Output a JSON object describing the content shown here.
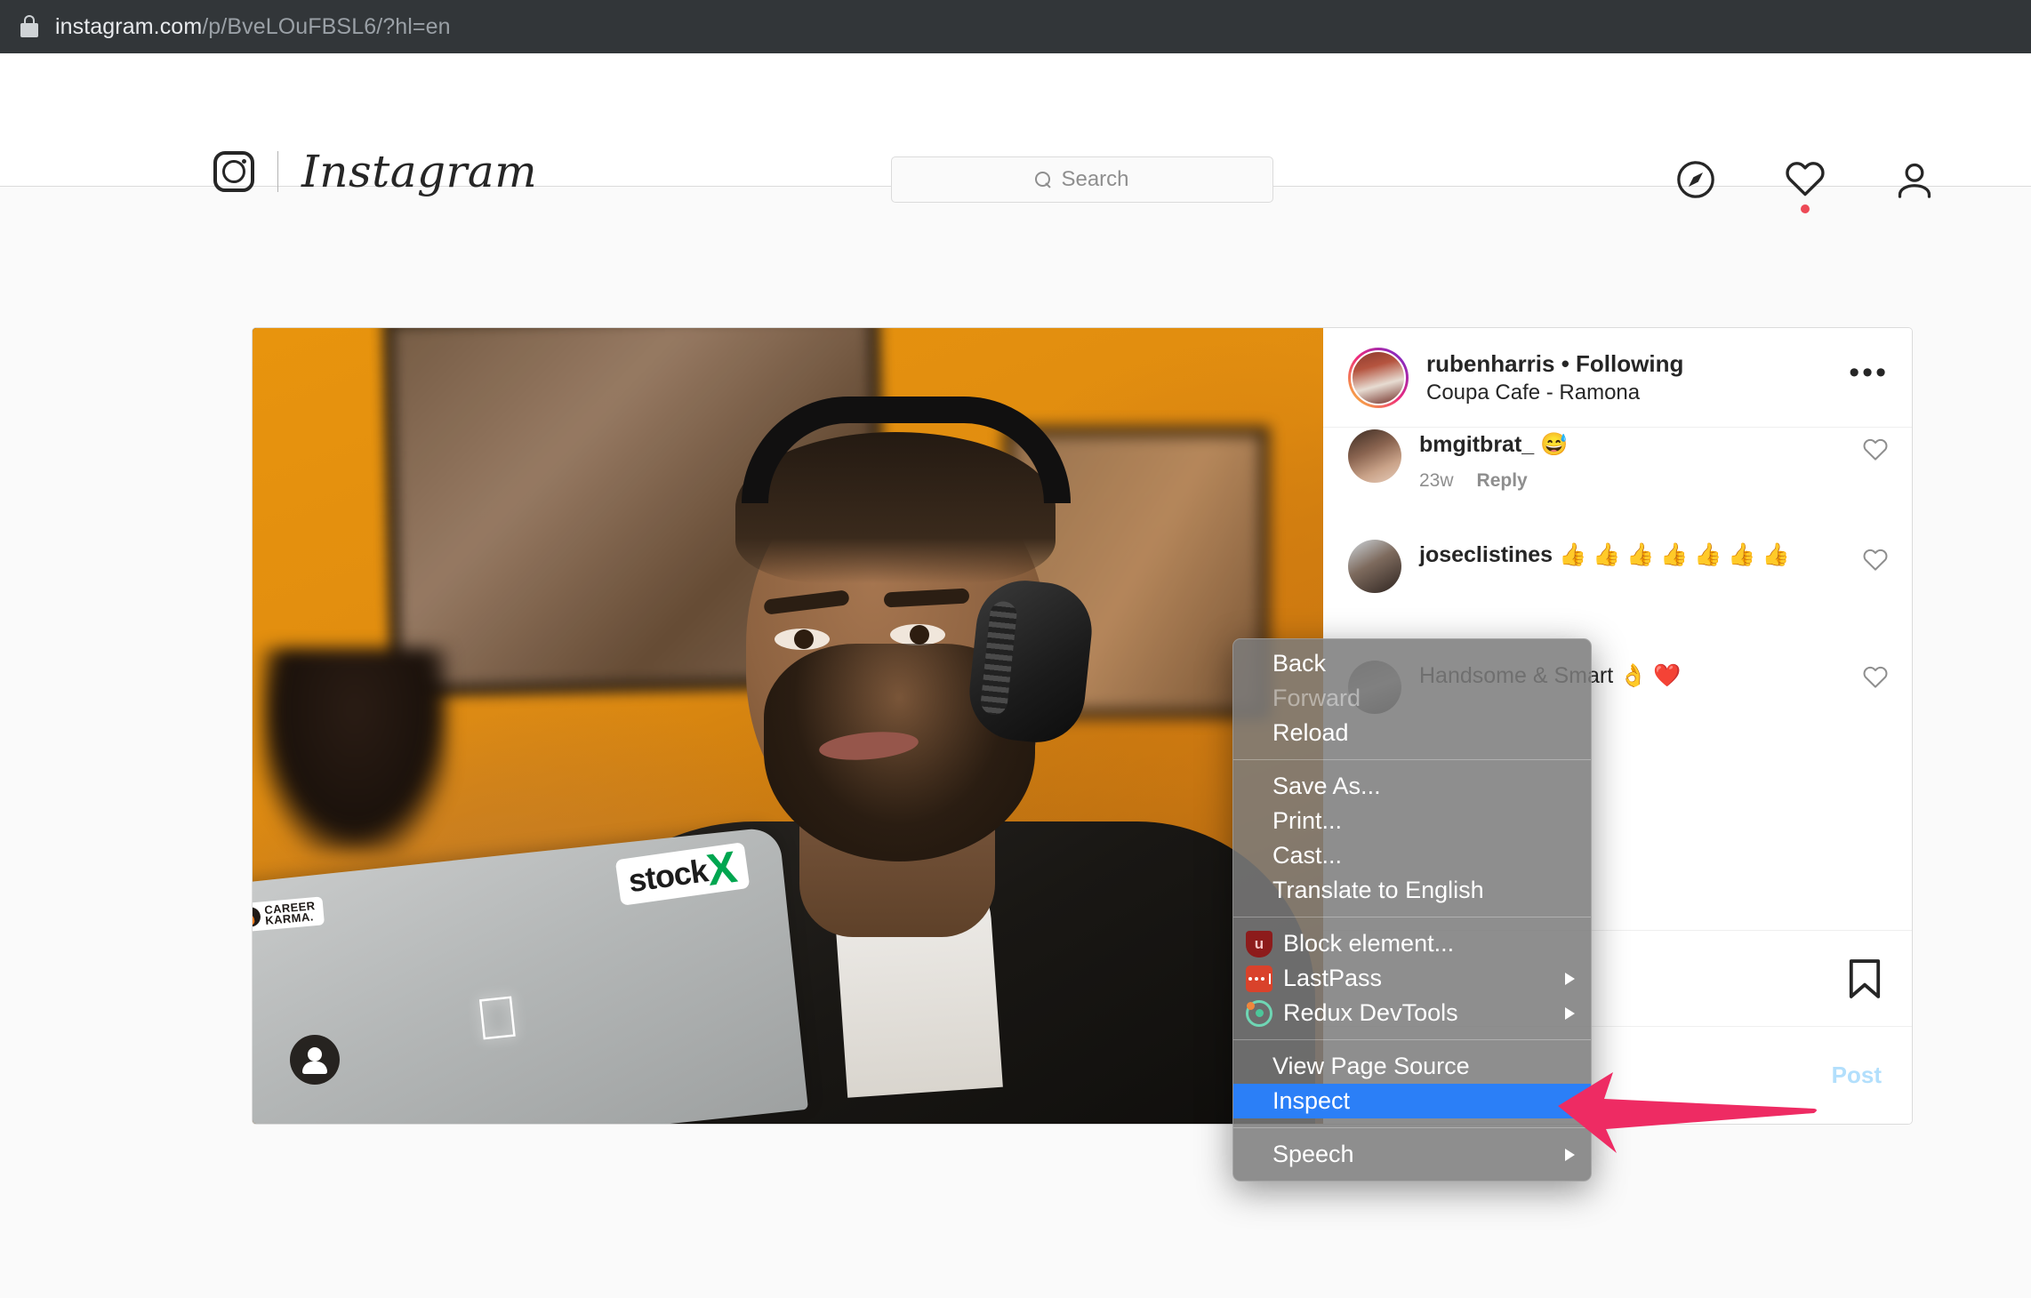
{
  "browser": {
    "lock_icon": "lock-icon",
    "url_domain": "instagram.com",
    "url_path": "/p/BveLOuFBSL6/?hl=en"
  },
  "nav": {
    "logo_icon": "instagram-camera-icon",
    "wordmark": "Instagram",
    "search": {
      "icon": "search-icon",
      "placeholder": "Search",
      "value": ""
    },
    "actions": [
      {
        "name": "explore-icon",
        "label": "Explore"
      },
      {
        "name": "activity-heart-icon",
        "label": "Activity",
        "badge": true
      },
      {
        "name": "profile-icon",
        "label": "Profile"
      }
    ]
  },
  "post": {
    "media": {
      "alt": "Man with headphones working on a MacBook in a cafe",
      "tag_badge_icon": "tagged-people-icon",
      "stickers": [
        {
          "name": "career-karma-sticker",
          "line1": "CAREER",
          "line2": "KARMA."
        },
        {
          "name": "stockx-sticker",
          "text": "stock",
          "accent": "X"
        }
      ],
      "apple_logo": ""
    },
    "header": {
      "avatar": "rubenharris-avatar",
      "username_line": "rubenharris • Following",
      "location": "Coupa Cafe - Ramona",
      "more_label": "•••"
    },
    "comments": [
      {
        "avatar": "commenter-avatar-1",
        "username": "bmgitbrat_",
        "text": " 😅",
        "time": "23w",
        "reply_label": "Reply",
        "like_icon": "heart-outline-icon"
      },
      {
        "avatar": "commenter-avatar-2",
        "username": "joseclistines",
        "text": " 👍 👍 👍 👍 👍 👍 👍",
        "time": "",
        "reply_label": "",
        "like_icon": "heart-outline-icon"
      },
      {
        "avatar": "commenter-avatar-3",
        "username": "",
        "text": "Handsome & Smart 👌 ❤️",
        "time": "",
        "reply_label": "",
        "like_icon": "heart-outline-icon"
      }
    ],
    "actions": {
      "save_icon": "bookmark-icon"
    },
    "compose": {
      "post_label": "Post"
    }
  },
  "context_menu": {
    "groups": [
      {
        "items": [
          {
            "label": "Back",
            "disabled": false,
            "icon": null,
            "submenu": false,
            "selected": false
          },
          {
            "label": "Forward",
            "disabled": true,
            "icon": null,
            "submenu": false,
            "selected": false
          },
          {
            "label": "Reload",
            "disabled": false,
            "icon": null,
            "submenu": false,
            "selected": false
          }
        ]
      },
      {
        "items": [
          {
            "label": "Save As...",
            "disabled": false,
            "icon": null,
            "submenu": false,
            "selected": false
          },
          {
            "label": "Print...",
            "disabled": false,
            "icon": null,
            "submenu": false,
            "selected": false
          },
          {
            "label": "Cast...",
            "disabled": false,
            "icon": null,
            "submenu": false,
            "selected": false
          },
          {
            "label": "Translate to English",
            "disabled": false,
            "icon": null,
            "submenu": false,
            "selected": false
          }
        ]
      },
      {
        "items": [
          {
            "label": "Block element...",
            "disabled": false,
            "icon": "ublock-origin-icon",
            "submenu": false,
            "selected": false
          },
          {
            "label": "LastPass",
            "disabled": false,
            "icon": "lastpass-icon",
            "submenu": true,
            "selected": false
          },
          {
            "label": "Redux DevTools",
            "disabled": false,
            "icon": "redux-devtools-icon",
            "submenu": true,
            "selected": false
          }
        ]
      },
      {
        "items": [
          {
            "label": "View Page Source",
            "disabled": false,
            "icon": null,
            "submenu": false,
            "selected": false
          },
          {
            "label": "Inspect",
            "disabled": false,
            "icon": null,
            "submenu": false,
            "selected": true
          }
        ]
      },
      {
        "items": [
          {
            "label": "Speech",
            "disabled": false,
            "icon": null,
            "submenu": true,
            "selected": false
          }
        ]
      }
    ]
  },
  "annotation": {
    "arrow_icon": "pink-pointer-arrow",
    "points_to": "Inspect"
  },
  "colors": {
    "urlbar_bg": "#323639",
    "accent_selected": "#2b7ff7",
    "annotation_pink": "#ee2b63",
    "notification_dot": "#ed4956",
    "post_button": "#b2dffc",
    "ig_text": "#262626",
    "ig_muted": "#8e8e8e"
  }
}
